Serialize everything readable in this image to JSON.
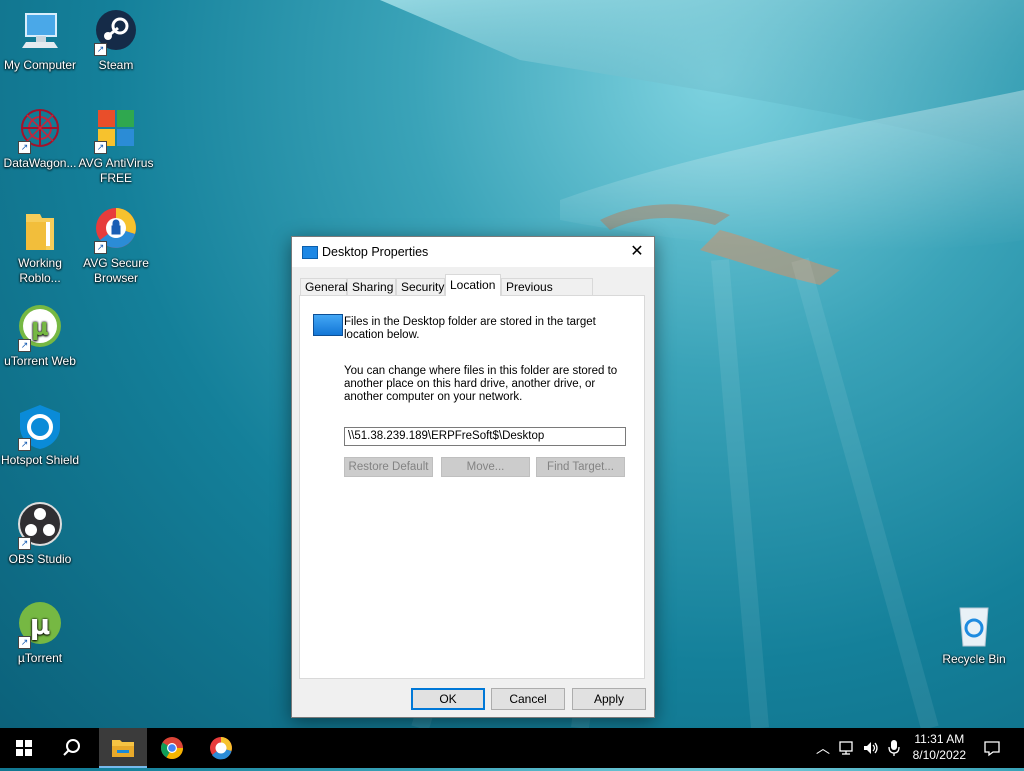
{
  "desktop": {
    "icons": [
      {
        "label": "My Computer"
      },
      {
        "label": "Steam"
      },
      {
        "label": "DataWagon..."
      },
      {
        "label": "AVG AntiVirus FREE"
      },
      {
        "label": "Working Roblo..."
      },
      {
        "label": "AVG Secure Browser"
      },
      {
        "label": "uTorrent Web"
      },
      {
        "label": "Hotspot Shield"
      },
      {
        "label": "OBS Studio"
      },
      {
        "label": "µTorrent"
      },
      {
        "label": "Recycle Bin"
      }
    ]
  },
  "dialog": {
    "title": "Desktop Properties",
    "tabs": [
      "General",
      "Sharing",
      "Security",
      "Location",
      "Previous Versions"
    ],
    "active_tab": "Location",
    "intro_text": "Files in the Desktop folder are stored in the target location below.",
    "change_text": "You can change where files in this folder are stored to another place on this hard drive, another drive, or another computer on your network.",
    "path_value": "\\\\51.38.239.189\\ERPFreSoft$\\Desktop",
    "restore_default_label": "Restore Default",
    "move_label": "Move...",
    "find_target_label": "Find Target...",
    "ok_label": "OK",
    "cancel_label": "Cancel",
    "apply_label": "Apply"
  },
  "taskbar": {
    "apps": [
      "windows-start-icon",
      "search-icon",
      "file-explorer-icon",
      "chrome-icon",
      "avg-browser-icon"
    ],
    "clock_time": "11:31 AM",
    "clock_date": "8/10/2022"
  },
  "colors": {
    "accent": "#0078d7",
    "taskbar": "#000000"
  }
}
